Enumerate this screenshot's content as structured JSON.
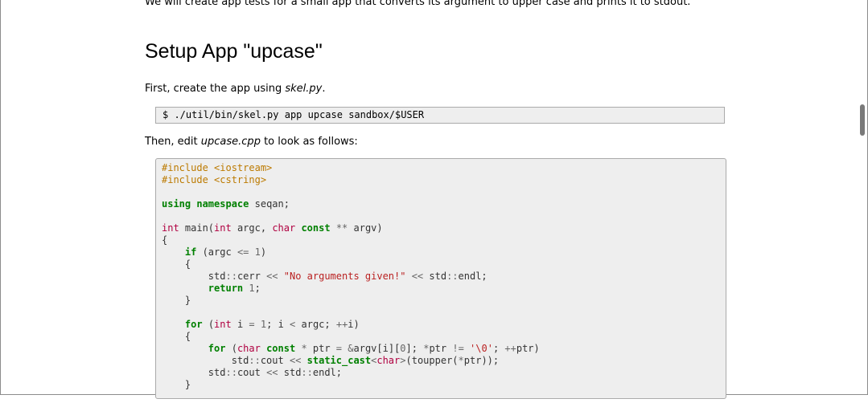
{
  "intro": "We will create app tests for a small app that converts its argument to upper case and prints it to stdout.",
  "heading": "Setup App \"upcase\"",
  "para1": {
    "before": "First, create the app using ",
    "em": "skel.py",
    "after": "."
  },
  "command": "$ ./util/bin/skel.py app upcase sandbox/$USER",
  "para2": {
    "before": "Then, edit ",
    "em": "upcase.cpp",
    "after": " to look as follows:"
  },
  "code_lines": [
    [
      {
        "c": "pp",
        "t": "#include <iostream>"
      }
    ],
    [
      {
        "c": "pp",
        "t": "#include <cstring>"
      }
    ],
    [],
    [
      {
        "c": "kw",
        "t": "using"
      },
      {
        "t": " "
      },
      {
        "c": "kw",
        "t": "namespace"
      },
      {
        "t": " seqan;"
      }
    ],
    [],
    [
      {
        "c": "ty",
        "t": "int"
      },
      {
        "t": " main("
      },
      {
        "c": "ty",
        "t": "int"
      },
      {
        "t": " argc, "
      },
      {
        "c": "ty",
        "t": "char"
      },
      {
        "t": " "
      },
      {
        "c": "kw",
        "t": "const"
      },
      {
        "t": " "
      },
      {
        "c": "op",
        "t": "**"
      },
      {
        "t": " argv)"
      }
    ],
    [
      {
        "t": "{"
      }
    ],
    [
      {
        "t": "    "
      },
      {
        "c": "kw",
        "t": "if"
      },
      {
        "t": " (argc "
      },
      {
        "c": "op",
        "t": "<="
      },
      {
        "t": " "
      },
      {
        "c": "nm",
        "t": "1"
      },
      {
        "t": ")"
      }
    ],
    [
      {
        "t": "    {"
      }
    ],
    [
      {
        "t": "        std"
      },
      {
        "c": "op",
        "t": "::"
      },
      {
        "t": "cerr "
      },
      {
        "c": "op",
        "t": "<<"
      },
      {
        "t": " "
      },
      {
        "c": "st",
        "t": "\"No arguments given!\""
      },
      {
        "t": " "
      },
      {
        "c": "op",
        "t": "<<"
      },
      {
        "t": " std"
      },
      {
        "c": "op",
        "t": "::"
      },
      {
        "t": "endl;"
      }
    ],
    [
      {
        "t": "        "
      },
      {
        "c": "kw",
        "t": "return"
      },
      {
        "t": " "
      },
      {
        "c": "nm",
        "t": "1"
      },
      {
        "t": ";"
      }
    ],
    [
      {
        "t": "    }"
      }
    ],
    [],
    [
      {
        "t": "    "
      },
      {
        "c": "kw",
        "t": "for"
      },
      {
        "t": " ("
      },
      {
        "c": "ty",
        "t": "int"
      },
      {
        "t": " i "
      },
      {
        "c": "op",
        "t": "="
      },
      {
        "t": " "
      },
      {
        "c": "nm",
        "t": "1"
      },
      {
        "t": "; i "
      },
      {
        "c": "op",
        "t": "<"
      },
      {
        "t": " argc; "
      },
      {
        "c": "op",
        "t": "++"
      },
      {
        "t": "i)"
      }
    ],
    [
      {
        "t": "    {"
      }
    ],
    [
      {
        "t": "        "
      },
      {
        "c": "kw",
        "t": "for"
      },
      {
        "t": " ("
      },
      {
        "c": "ty",
        "t": "char"
      },
      {
        "t": " "
      },
      {
        "c": "kw",
        "t": "const"
      },
      {
        "t": " "
      },
      {
        "c": "op",
        "t": "*"
      },
      {
        "t": " ptr "
      },
      {
        "c": "op",
        "t": "="
      },
      {
        "t": " "
      },
      {
        "c": "op",
        "t": "&"
      },
      {
        "t": "argv[i]["
      },
      {
        "c": "nm",
        "t": "0"
      },
      {
        "t": "]; "
      },
      {
        "c": "op",
        "t": "*"
      },
      {
        "t": "ptr "
      },
      {
        "c": "op",
        "t": "!="
      },
      {
        "t": " "
      },
      {
        "c": "st",
        "t": "'\\0'"
      },
      {
        "t": "; "
      },
      {
        "c": "op",
        "t": "++"
      },
      {
        "t": "ptr)"
      }
    ],
    [
      {
        "t": "            std"
      },
      {
        "c": "op",
        "t": "::"
      },
      {
        "t": "cout "
      },
      {
        "c": "op",
        "t": "<<"
      },
      {
        "t": " "
      },
      {
        "c": "kw",
        "t": "static_cast"
      },
      {
        "c": "op",
        "t": "<"
      },
      {
        "c": "ty",
        "t": "char"
      },
      {
        "c": "op",
        "t": ">"
      },
      {
        "t": "(toupper("
      },
      {
        "c": "op",
        "t": "*"
      },
      {
        "t": "ptr));"
      }
    ],
    [
      {
        "t": "        std"
      },
      {
        "c": "op",
        "t": "::"
      },
      {
        "t": "cout "
      },
      {
        "c": "op",
        "t": "<<"
      },
      {
        "t": " std"
      },
      {
        "c": "op",
        "t": "::"
      },
      {
        "t": "endl;"
      }
    ],
    [
      {
        "t": "    }"
      }
    ],
    [
      {
        "t": ""
      }
    ]
  ]
}
